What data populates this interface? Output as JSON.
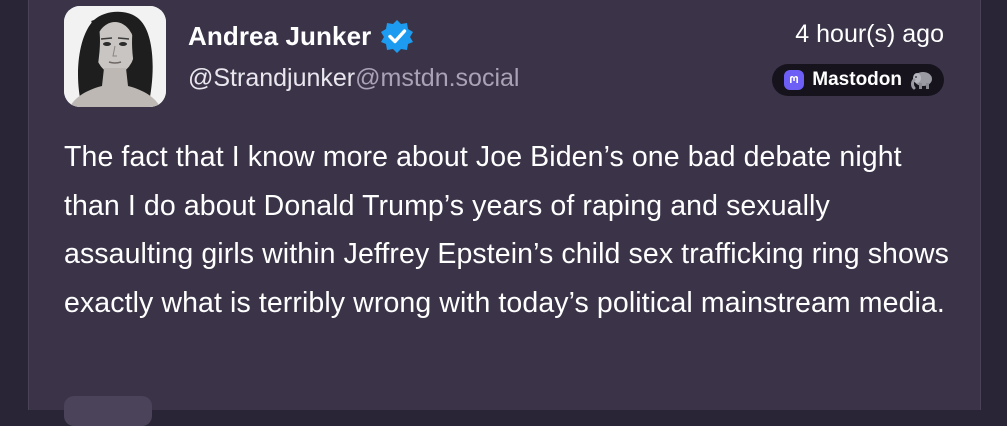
{
  "post": {
    "author_name": "Andrea Junker",
    "handle_user": "@Strandjunker",
    "handle_domain": "@mstdn.social",
    "timestamp": "4 hour(s) ago",
    "source_label": "Mastodon",
    "text": "The fact that I know more about Joe Biden’s one bad debate night than I do about Donald Trump’s years of raping and sexually assaulting girls within Jeffrey Epstein’s child sex trafficking ring shows exactly what is terribly wrong with today’s political mainstream media."
  },
  "icons": {
    "verified": "verified-check-icon",
    "source": "mastodon-logo-icon",
    "source_emoji": "elephant-icon"
  },
  "colors": {
    "card_background": "#3b3449",
    "page_background": "#2a2536",
    "verified_blue": "#1d9bf0",
    "mastodon_purple": "#6d5ef5",
    "handle_domain_gray": "#aaa3b6"
  }
}
